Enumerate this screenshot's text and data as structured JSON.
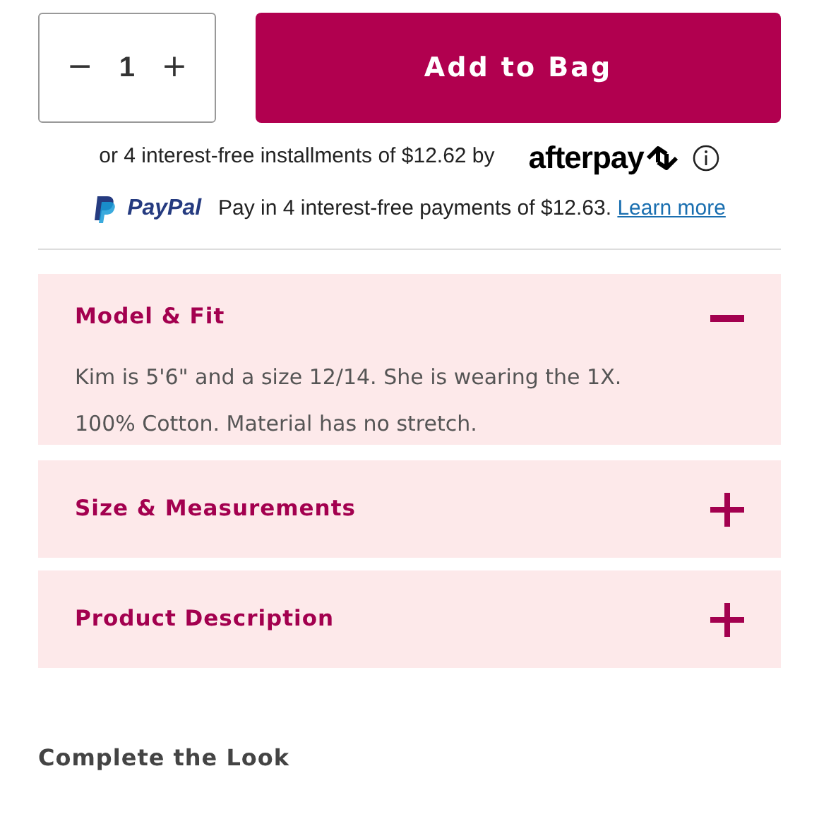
{
  "quantity": {
    "decrement": "−",
    "value": "1",
    "increment": "+"
  },
  "add_button": "Add to Bag",
  "afterpay": {
    "text": "or 4 interest-free installments of $12.62 by",
    "brand": "afterpay"
  },
  "paypal": {
    "brand": "PayPal",
    "text": "Pay in 4 interest-free payments of $12.63.",
    "link": "Learn more"
  },
  "accordion": [
    {
      "title": "Model & Fit",
      "expanded": true,
      "lines": [
        "Kim is 5'6\" and a size 12/14. She is wearing the 1X.",
        "100% Cotton. Material has no stretch."
      ]
    },
    {
      "title": "Size & Measurements",
      "expanded": false
    },
    {
      "title": "Product Description",
      "expanded": false
    }
  ],
  "section_heading": "Complete the Look"
}
